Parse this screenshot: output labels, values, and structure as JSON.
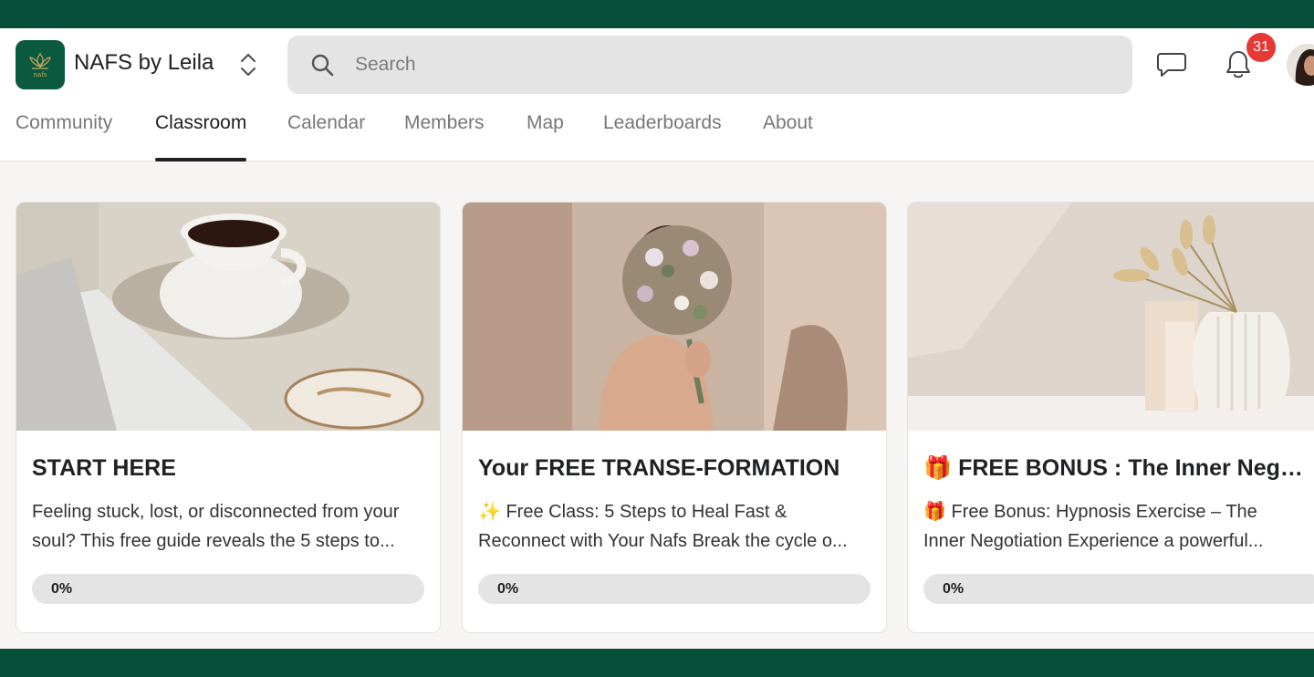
{
  "brand": {
    "name": "NAFS by Leila",
    "logo_text": "nafs"
  },
  "search": {
    "placeholder": "Search"
  },
  "notifications": {
    "count": "31"
  },
  "colors": {
    "brand_green": "#064d3a",
    "badge_red": "#e53935",
    "active_tab": "#202124"
  },
  "nav": {
    "tabs": [
      {
        "label": "Community",
        "active": false
      },
      {
        "label": "Classroom",
        "active": true
      },
      {
        "label": "Calendar",
        "active": false
      },
      {
        "label": "Members",
        "active": false
      },
      {
        "label": "Map",
        "active": false
      },
      {
        "label": "Leaderboards",
        "active": false
      },
      {
        "label": "About",
        "active": false
      }
    ]
  },
  "courses": [
    {
      "title": "START HERE",
      "desc_line1": "Feeling stuck, lost, or disconnected from your",
      "desc_line2": "soul? This free guide reveals the 5 steps to...",
      "progress_label": "0%",
      "progress": 0,
      "image": "coffee-cup-image"
    },
    {
      "title": "Your FREE TRANSE-FORMATION",
      "desc_line1": "✨ Free Class: 5 Steps to Heal Fast &",
      "desc_line2": "Reconnect with Your Nafs Break the cycle o...",
      "progress_label": "0%",
      "progress": 0,
      "image": "woman-flowers-image"
    },
    {
      "title": "🎁 FREE BONUS : The Inner Negot...",
      "desc_line1": "🎁 Free Bonus: Hypnosis Exercise – The",
      "desc_line2": "Inner Negotiation Experience a powerful...",
      "progress_label": "0%",
      "progress": 0,
      "image": "dried-flowers-vase-image"
    }
  ]
}
